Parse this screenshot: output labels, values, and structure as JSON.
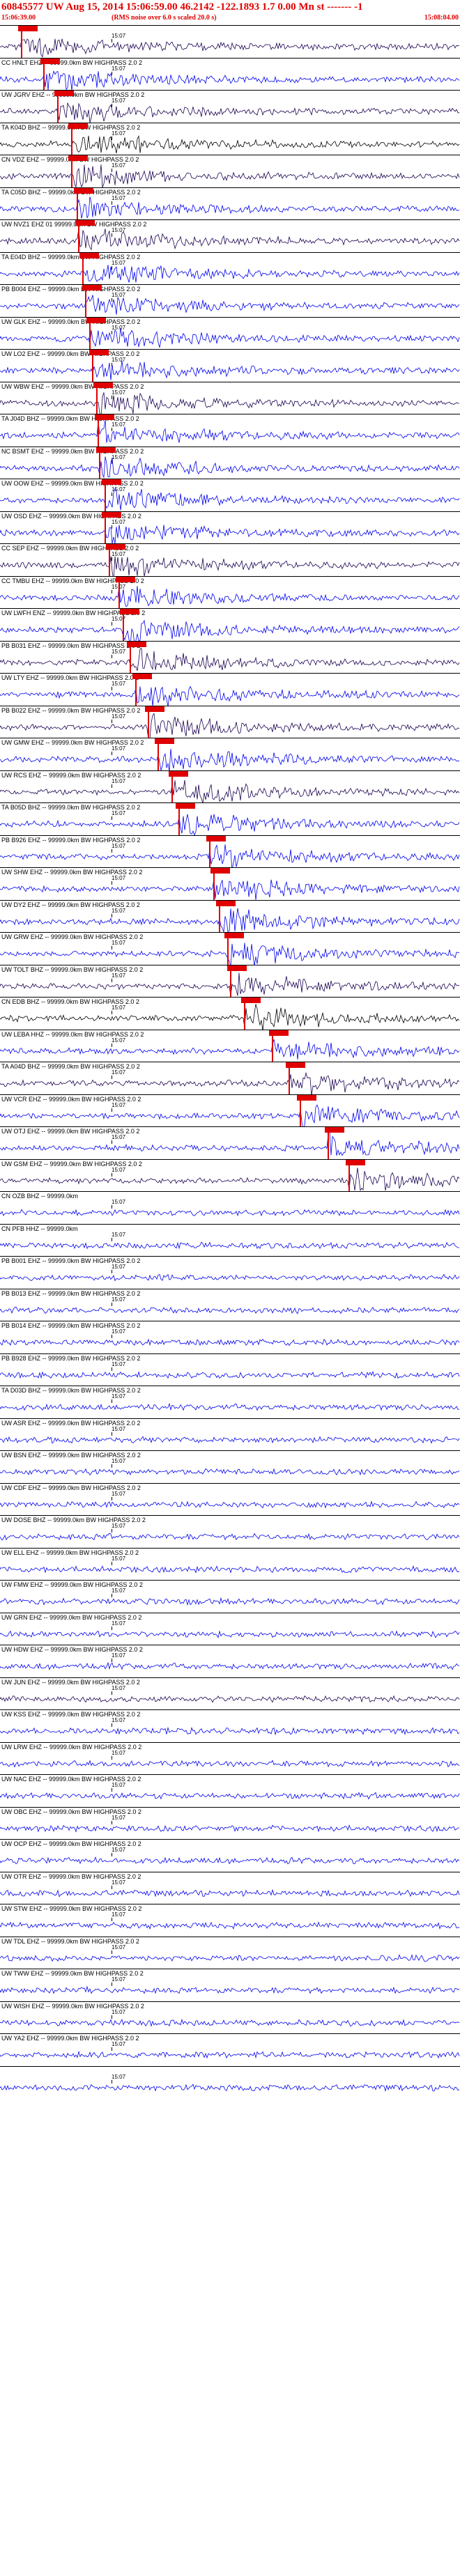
{
  "header": {
    "title": "60845577 UW Aug 15, 2014 15:06:59.00    46.2142 -122.1893  1.7 0.00 Mn st ------- -1",
    "start_time": "15:06:39.00",
    "note": "(RMS noise over 6.0 s scaled 20.0 s)",
    "end_time": "15:08:04.00"
  },
  "colors": {
    "header": "#e00000",
    "pick": "#e00000",
    "trace_blue": "#0000ee",
    "trace_dark": "#1a0050",
    "trace_black": "#000000"
  },
  "tick_label": "15:07",
  "channels": [
    {
      "label": "",
      "color": "#1a0050"
    },
    {
      "label": "CC HNLT EHZ -- 99999.0km BW  HIGHPASS  2.0  2",
      "color": "#0000ee"
    },
    {
      "label": "UW JGRV EHZ -- 99999.0km BW  HIGHPASS  2.0  2",
      "color": "#1a0050"
    },
    {
      "label": "TA K04D BHZ -- 99999.0km BW  HIGHPASS  2.0  2",
      "color": "#000000"
    },
    {
      "label": "CN VDZ EHZ -- 99999.0km BW  HIGHPASS  2.0  2",
      "color": "#1a0050"
    },
    {
      "label": "TA C05D BHZ -- 99999.0km BW  HIGHPASS  2.0  2",
      "color": "#0000ee"
    },
    {
      "label": "UW NVZ1 EHZ 01 99999.0km BW  HIGHPASS  2.0  2",
      "color": "#1a0050"
    },
    {
      "label": "TA E04D BHZ -- 99999.0km BW  HIGHPASS  2.0  2",
      "color": "#0000ee"
    },
    {
      "label": "PB B004 EHZ -- 99999.0km BW  HIGHPASS  2.0  2",
      "color": "#0000ee"
    },
    {
      "label": "UW GLK EHZ -- 99999.0km BW  HIGHPASS  2.0  2",
      "color": "#0000ee"
    },
    {
      "label": "UW LO2 EHZ -- 99999.0km BW  HIGHPASS  2.0  2",
      "color": "#0000ee"
    },
    {
      "label": "UW WBW EHZ -- 99999.0km BW  HIGHPASS  2.0  2",
      "color": "#1a0050"
    },
    {
      "label": "TA J04D BHZ -- 99999.0km BW  HIGHPASS  2.0  2",
      "color": "#0000ee"
    },
    {
      "label": "NC BSMT EHZ -- 99999.0km BW  HIGHPASS  2.0  2",
      "color": "#0000ee"
    },
    {
      "label": "UW OOW EHZ -- 99999.0km BW  HIGHPASS  2.0  2",
      "color": "#0000ee"
    },
    {
      "label": "UW OSD EHZ -- 99999.0km BW  HIGHPASS  2.0  2",
      "color": "#0000ee"
    },
    {
      "label": "CC SEP EHZ -- 99999.0km BW  HIGHPASS  2.0  2",
      "color": "#1a0050"
    },
    {
      "label": "CC TMBU EHZ -- 99999.0km BW  HIGHPASS  2.0  2",
      "color": "#0000ee"
    },
    {
      "label": "UW LWFH ENZ -- 99999.0km BW  HIGHPASS  2.0  2",
      "color": "#0000ee"
    },
    {
      "label": "PB B031 EHZ -- 99999.0km BW  HIGHPASS  2.0  2",
      "color": "#1a0050"
    },
    {
      "label": "UW LTY EHZ -- 99999.0km BW  HIGHPASS  2.0  2",
      "color": "#0000ee"
    },
    {
      "label": "PB B022 EHZ -- 99999.0km BW  HIGHPASS  2.0  2",
      "color": "#1a0050"
    },
    {
      "label": "UW GMW EHZ -- 99999.0km BW  HIGHPASS  2.0  2",
      "color": "#0000ee"
    },
    {
      "label": "UW RCS EHZ -- 99999.0km BW  HIGHPASS  2.0  2",
      "color": "#1a0050"
    },
    {
      "label": "TA B05D BHZ -- 99999.0km BW  HIGHPASS  2.0  2",
      "color": "#0000ee"
    },
    {
      "label": "PB B926 EHZ -- 99999.0km BW  HIGHPASS  2.0  2",
      "color": "#0000ee"
    },
    {
      "label": "UW SHW EHZ -- 99999.0km BW  HIGHPASS  2.0  2",
      "color": "#0000ee"
    },
    {
      "label": "UW DY2 EHZ -- 99999.0km BW  HIGHPASS  2.0  2",
      "color": "#0000ee"
    },
    {
      "label": "UW GRW EHZ -- 99999.0km BW  HIGHPASS  2.0  2",
      "color": "#0000ee"
    },
    {
      "label": "UW TOLT BHZ -- 99999.0km BW  HIGHPASS  2.0  2",
      "color": "#1a0050"
    },
    {
      "label": "CN EDB BHZ -- 99999.0km BW  HIGHPASS  2.0  2",
      "color": "#000000"
    },
    {
      "label": "UW LEBA HHZ -- 99999.0km BW  HIGHPASS  2.0  2",
      "color": "#0000ee"
    },
    {
      "label": "TA A04D BHZ -- 99999.0km BW  HIGHPASS  2.0  2",
      "color": "#1a0050"
    },
    {
      "label": "UW VCR EHZ -- 99999.0km BW  HIGHPASS  2.0  2",
      "color": "#0000ee"
    },
    {
      "label": "UW OTJ EHZ -- 99999.0km BW  HIGHPASS  2.0  2",
      "color": "#0000ee"
    },
    {
      "label": "UW GSM EHZ -- 99999.0km BW  HIGHPASS  2.0  2",
      "color": "#1a0050"
    },
    {
      "label": "CN OZB BHZ -- 99999.0km",
      "color": "#0000ee"
    },
    {
      "label": "CN PFB HHZ -- 99999.0km",
      "color": "#0000ee"
    },
    {
      "label": "PB B001 EHZ -- 99999.0km BW  HIGHPASS  2.0  2",
      "color": "#0000ee"
    },
    {
      "label": "PB B013 EHZ -- 99999.0km BW  HIGHPASS  2.0  2",
      "color": "#0000ee"
    },
    {
      "label": "PB B014 EHZ -- 99999.0km BW  HIGHPASS  2.0  2",
      "color": "#0000ee"
    },
    {
      "label": "PB B928 EHZ -- 99999.0km BW  HIGHPASS  2.0  2",
      "color": "#0000ee"
    },
    {
      "label": "TA D03D BHZ -- 99999.0km BW  HIGHPASS  2.0  2",
      "color": "#0000ee"
    },
    {
      "label": "UW ASR EHZ -- 99999.0km BW  HIGHPASS  2.0  2",
      "color": "#0000ee"
    },
    {
      "label": "UW BSN EHZ -- 99999.0km BW  HIGHPASS  2.0  2",
      "color": "#0000ee"
    },
    {
      "label": "UW CDF EHZ -- 99999.0km BW  HIGHPASS  2.0  2",
      "color": "#0000ee"
    },
    {
      "label": "UW DOSE BHZ -- 99999.0km BW  HIGHPASS  2.0  2",
      "color": "#0000ee"
    },
    {
      "label": "UW ELL EHZ -- 99999.0km BW  HIGHPASS  2.0  2",
      "color": "#0000ee"
    },
    {
      "label": "UW FMW EHZ -- 99999.0km BW  HIGHPASS  2.0  2",
      "color": "#0000ee"
    },
    {
      "label": "UW GRN EHZ -- 99999.0km BW  HIGHPASS  2.0  2",
      "color": "#0000ee"
    },
    {
      "label": "UW HDW EHZ -- 99999.0km BW  HIGHPASS  2.0  2",
      "color": "#0000ee"
    },
    {
      "label": "UW JUN EHZ -- 99999.0km BW  HIGHPASS  2.0  2",
      "color": "#1a0050"
    },
    {
      "label": "UW KSS EHZ -- 99999.0km BW  HIGHPASS  2.0  2",
      "color": "#0000ee"
    },
    {
      "label": "UW LRW EHZ -- 99999.0km BW  HIGHPASS  2.0  2",
      "color": "#0000ee"
    },
    {
      "label": "UW NAC EHZ -- 99999.0km BW  HIGHPASS  2.0  2",
      "color": "#0000ee"
    },
    {
      "label": "UW OBC EHZ -- 99999.0km BW  HIGHPASS  2.0  2",
      "color": "#0000ee"
    },
    {
      "label": "UW OCP EHZ -- 99999.0km BW  HIGHPASS  2.0  2",
      "color": "#0000ee"
    },
    {
      "label": "UW OTR EHZ -- 99999.0km BW  HIGHPASS  2.0  2",
      "color": "#0000ee"
    },
    {
      "label": "UW STW EHZ -- 99999.0km BW  HIGHPASS  2.0  2",
      "color": "#0000ee"
    },
    {
      "label": "UW TDL EHZ -- 99999.0km BW  HIGHPASS  2.0  2",
      "color": "#0000ee"
    },
    {
      "label": "UW TWW EHZ -- 99999.0km BW  HIGHPASS  2.0  2",
      "color": "#0000ee"
    },
    {
      "label": "UW WISH EHZ -- 99999.0km BW  HIGHPASS  2.0  2",
      "color": "#0000ee"
    },
    {
      "label": "UW YA2 EHZ -- 99999.0km BW  HIGHPASS  2.0  2",
      "color": "#0000ee"
    },
    {
      "label": "",
      "color": "#0000ee"
    }
  ]
}
